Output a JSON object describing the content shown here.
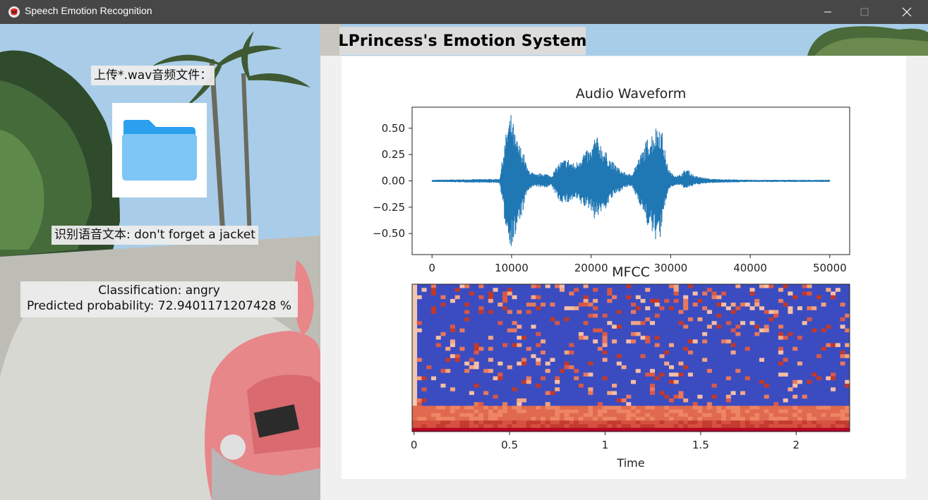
{
  "window": {
    "title": "Speech Emotion Recognition"
  },
  "header": {
    "title": "LPrincess's Emotion System"
  },
  "left": {
    "upload_label": "上传*.wav音频文件：",
    "upload_icon": "folder-icon",
    "speech_text": "识别语音文本: don't forget a jacket",
    "classification": "Classification: angry",
    "probability": "Predicted probability: 72.9401171207428 %"
  },
  "colors": {
    "folder_back": "#2aa0ee",
    "folder_front": "#7ec6f6",
    "waveform": "#1f77b4",
    "mfcc_low": "#3b4cc0",
    "mfcc_high": "#b40426"
  },
  "chart_data": [
    {
      "type": "line",
      "title": "Audio Waveform",
      "xlabel": "",
      "ylabel": "",
      "xlim": [
        -2500,
        52500
      ],
      "ylim": [
        -0.7,
        0.7
      ],
      "xticks": [
        0,
        10000,
        20000,
        30000,
        40000,
        50000
      ],
      "xtick_labels": [
        "0",
        "10000",
        "20000",
        "30000",
        "40000",
        "50000"
      ],
      "yticks": [
        0.5,
        0.25,
        0.0,
        -0.25,
        -0.5
      ],
      "ytick_labels": [
        "0.50",
        "0.25",
        "0.00",
        "−0.25",
        "−0.50"
      ],
      "series": [
        {
          "envelope_x": [
            0,
            8500,
            9000,
            9500,
            10000,
            10500,
            11000,
            11500,
            12000,
            13000,
            14000,
            15000,
            16000,
            17000,
            18000,
            19000,
            20000,
            20500,
            21000,
            21500,
            22000,
            22500,
            23000,
            24000,
            25000,
            26000,
            26500,
            27000,
            27500,
            28000,
            28500,
            29000,
            29500,
            30000,
            31000,
            32000,
            33000,
            35000,
            40000,
            45000,
            50000
          ],
          "envelope_pos": [
            0.01,
            0.02,
            0.3,
            0.56,
            0.65,
            0.42,
            0.35,
            0.28,
            0.12,
            0.06,
            0.08,
            0.05,
            0.18,
            0.22,
            0.16,
            0.28,
            0.3,
            0.44,
            0.4,
            0.32,
            0.26,
            0.2,
            0.16,
            0.09,
            0.06,
            0.22,
            0.3,
            0.4,
            0.45,
            0.5,
            0.58,
            0.45,
            0.18,
            0.08,
            0.05,
            0.12,
            0.05,
            0.02,
            0.01,
            0.01,
            0.01
          ],
          "envelope_neg": [
            -0.01,
            -0.02,
            -0.32,
            -0.55,
            -0.63,
            -0.55,
            -0.4,
            -0.28,
            -0.1,
            -0.05,
            -0.07,
            -0.05,
            -0.2,
            -0.22,
            -0.18,
            -0.25,
            -0.28,
            -0.38,
            -0.32,
            -0.3,
            -0.25,
            -0.18,
            -0.14,
            -0.08,
            -0.05,
            -0.2,
            -0.3,
            -0.42,
            -0.5,
            -0.55,
            -0.6,
            -0.45,
            -0.15,
            -0.06,
            -0.04,
            -0.08,
            -0.04,
            -0.02,
            -0.01,
            -0.01,
            -0.01
          ]
        }
      ]
    },
    {
      "type": "heatmap",
      "title": "MFCC",
      "xlabel": "Time",
      "ylabel": "",
      "xlim": [
        -0.01,
        2.28
      ],
      "xticks": [
        0,
        0.5,
        1,
        1.5,
        2
      ],
      "xtick_labels": [
        "0",
        "0.5",
        "1",
        "1.5",
        "2"
      ],
      "grid_cols": 92,
      "grid_rows": 40
    }
  ]
}
